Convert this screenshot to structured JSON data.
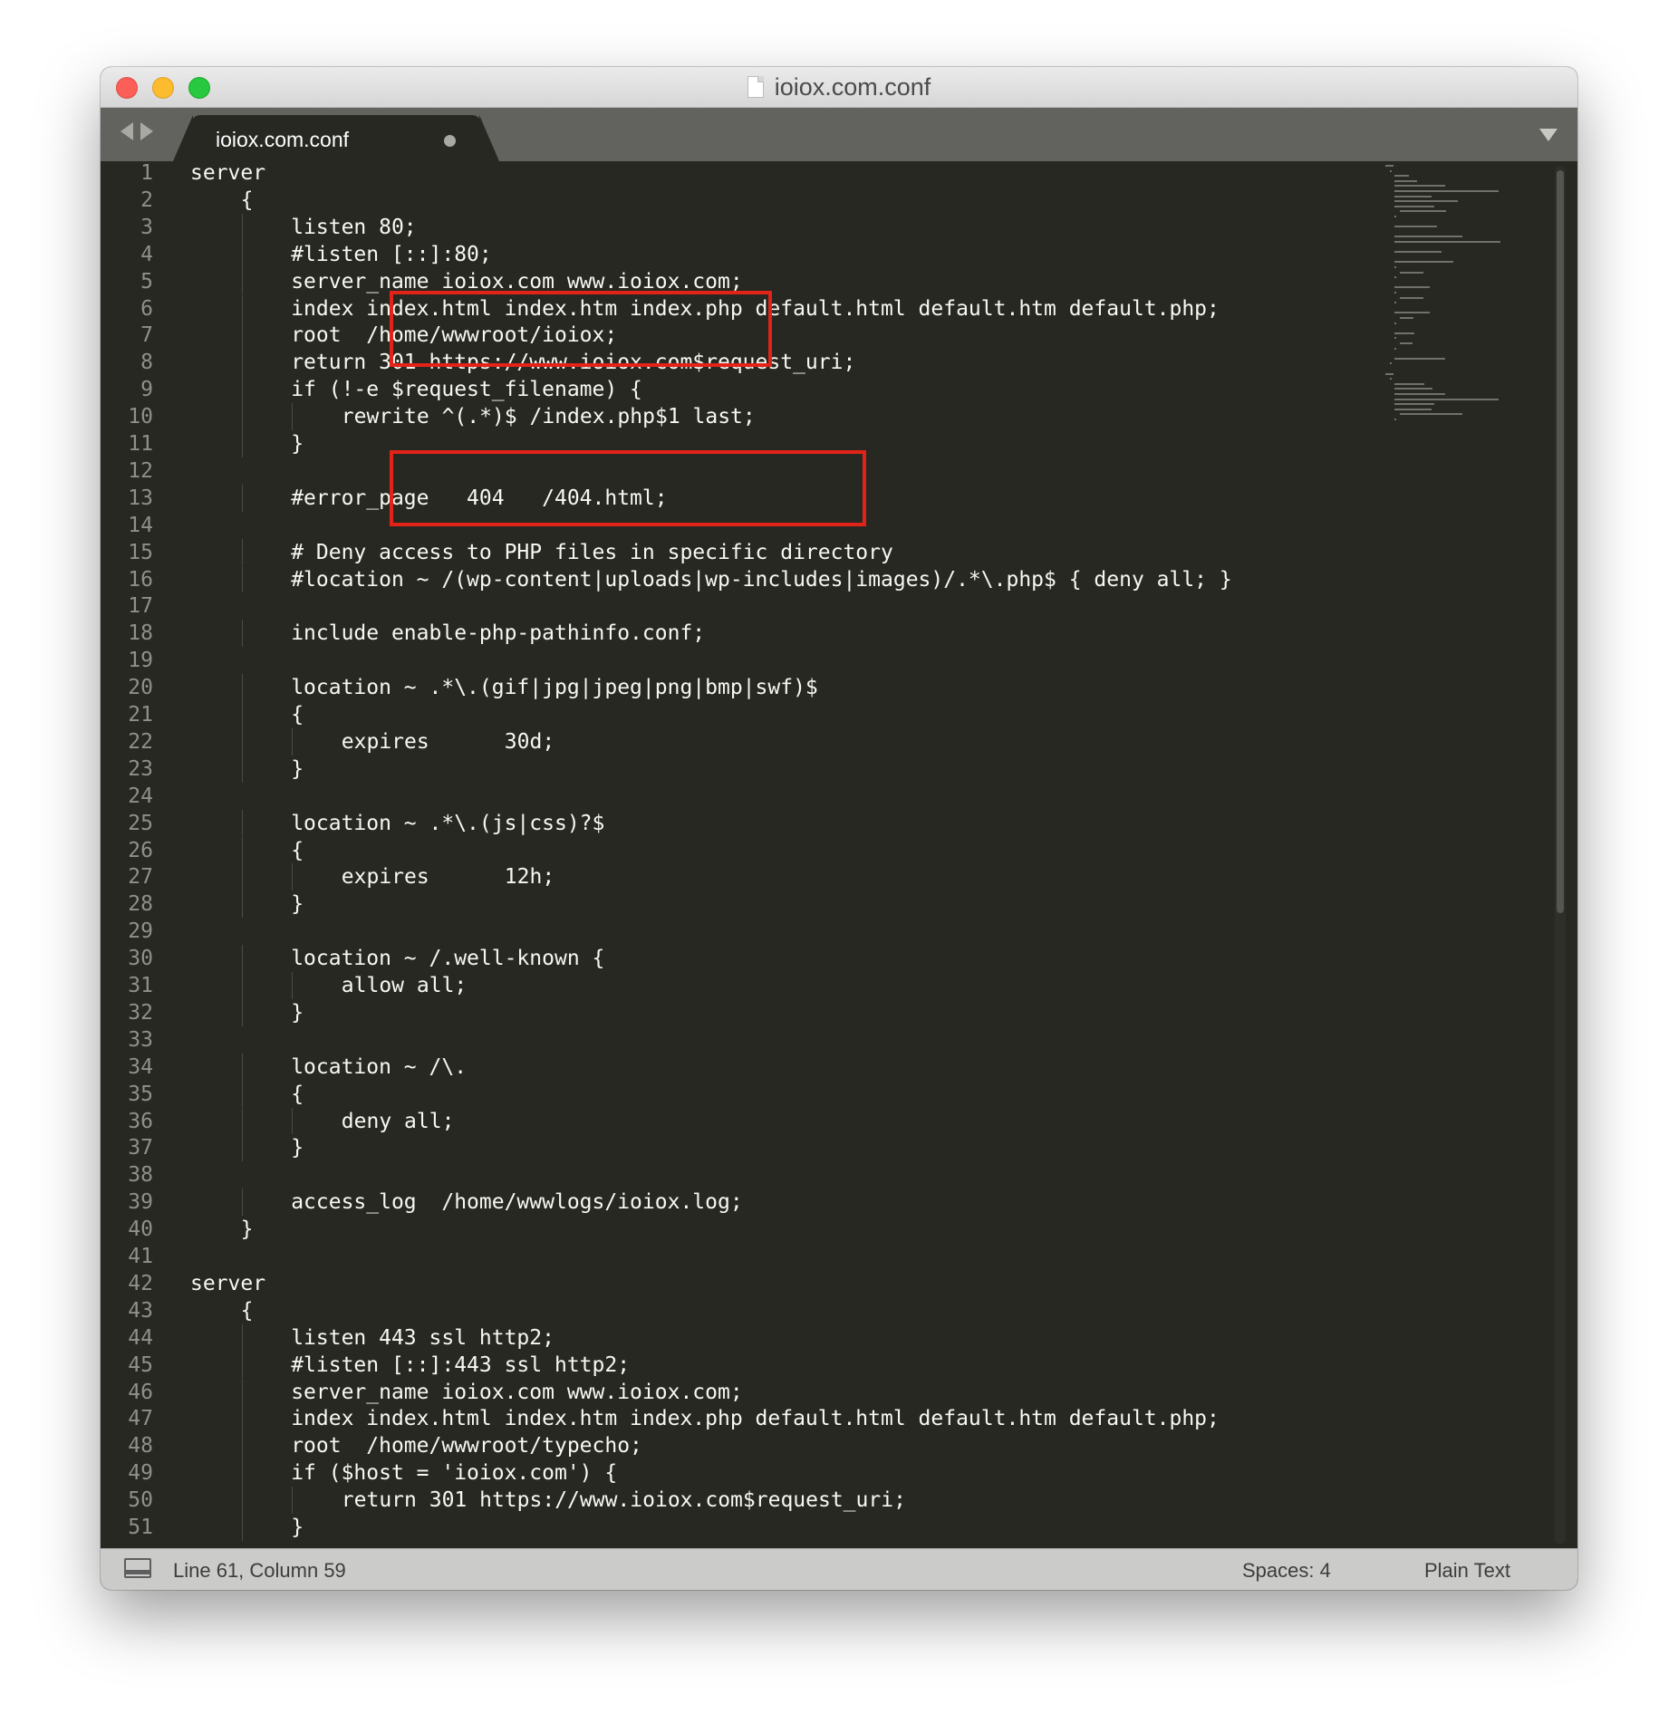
{
  "window": {
    "title": "ioiox.com.conf"
  },
  "tab": {
    "label": "ioiox.com.conf"
  },
  "editor": {
    "lines": [
      {
        "n": "1",
        "text": "server",
        "indent": 0
      },
      {
        "n": "2",
        "text": "{",
        "indent": 4
      },
      {
        "n": "3",
        "text": "listen 80;",
        "indent": 8
      },
      {
        "n": "4",
        "text": "#listen [::]:80;",
        "indent": 8
      },
      {
        "n": "5",
        "text": "server_name ioiox.com www.ioiox.com;",
        "indent": 8
      },
      {
        "n": "6",
        "text": "index index.html index.htm index.php default.html default.htm default.php;",
        "indent": 8
      },
      {
        "n": "7",
        "text": "root  /home/wwwroot/ioiox;",
        "indent": 8
      },
      {
        "n": "8",
        "text": "return 301 https://www.ioiox.com$request_uri;",
        "indent": 8
      },
      {
        "n": "9",
        "text": "if (!-e $request_filename) {",
        "indent": 8
      },
      {
        "n": "10",
        "text": "rewrite ^(.*)$ /index.php$1 last;",
        "indent": 12
      },
      {
        "n": "11",
        "text": "}",
        "indent": 8
      },
      {
        "n": "12",
        "text": "",
        "indent": 0
      },
      {
        "n": "13",
        "text": "#error_page   404   /404.html;",
        "indent": 8
      },
      {
        "n": "14",
        "text": "",
        "indent": 0
      },
      {
        "n": "15",
        "text": "# Deny access to PHP files in specific directory",
        "indent": 8
      },
      {
        "n": "16",
        "text": "#location ~ /(wp-content|uploads|wp-includes|images)/.*\\.php$ { deny all; }",
        "indent": 8
      },
      {
        "n": "17",
        "text": "",
        "indent": 0
      },
      {
        "n": "18",
        "text": "include enable-php-pathinfo.conf;",
        "indent": 8
      },
      {
        "n": "19",
        "text": "",
        "indent": 0
      },
      {
        "n": "20",
        "text": "location ~ .*\\.(gif|jpg|jpeg|png|bmp|swf)$",
        "indent": 8
      },
      {
        "n": "21",
        "text": "{",
        "indent": 8
      },
      {
        "n": "22",
        "text": "expires      30d;",
        "indent": 12
      },
      {
        "n": "23",
        "text": "}",
        "indent": 8
      },
      {
        "n": "24",
        "text": "",
        "indent": 0
      },
      {
        "n": "25",
        "text": "location ~ .*\\.(js|css)?$",
        "indent": 8
      },
      {
        "n": "26",
        "text": "{",
        "indent": 8
      },
      {
        "n": "27",
        "text": "expires      12h;",
        "indent": 12
      },
      {
        "n": "28",
        "text": "}",
        "indent": 8
      },
      {
        "n": "29",
        "text": "",
        "indent": 0
      },
      {
        "n": "30",
        "text": "location ~ /.well-known {",
        "indent": 8
      },
      {
        "n": "31",
        "text": "allow all;",
        "indent": 12
      },
      {
        "n": "32",
        "text": "}",
        "indent": 8
      },
      {
        "n": "33",
        "text": "",
        "indent": 0
      },
      {
        "n": "34",
        "text": "location ~ /\\.",
        "indent": 8
      },
      {
        "n": "35",
        "text": "{",
        "indent": 8
      },
      {
        "n": "36",
        "text": "deny all;",
        "indent": 12
      },
      {
        "n": "37",
        "text": "}",
        "indent": 8
      },
      {
        "n": "38",
        "text": "",
        "indent": 0
      },
      {
        "n": "39",
        "text": "access_log  /home/wwwlogs/ioiox.log;",
        "indent": 8
      },
      {
        "n": "40",
        "text": "}",
        "indent": 4
      },
      {
        "n": "41",
        "text": "",
        "indent": 0
      },
      {
        "n": "42",
        "text": "server",
        "indent": 0
      },
      {
        "n": "43",
        "text": "{",
        "indent": 4
      },
      {
        "n": "44",
        "text": "listen 443 ssl http2;",
        "indent": 8
      },
      {
        "n": "45",
        "text": "#listen [::]:443 ssl http2;",
        "indent": 8
      },
      {
        "n": "46",
        "text": "server_name ioiox.com www.ioiox.com;",
        "indent": 8
      },
      {
        "n": "47",
        "text": "index index.html index.htm index.php default.html default.htm default.php;",
        "indent": 8
      },
      {
        "n": "48",
        "text": "root  /home/wwwroot/typecho;",
        "indent": 8
      },
      {
        "n": "49",
        "text": "if ($host = 'ioiox.com') {",
        "indent": 8
      },
      {
        "n": "50",
        "text": "return 301 https://www.ioiox.com$request_uri;",
        "indent": 12
      },
      {
        "n": "51",
        "text": "}",
        "indent": 8
      }
    ]
  },
  "status": {
    "position": "Line 61, Column 59",
    "indentation": "Spaces: 4",
    "syntax": "Plain Text"
  },
  "colors": {
    "editor_background": "#272822",
    "text": "#f8f8f2",
    "line_numbers": "#90908a",
    "annotation_box": "#e2231a"
  }
}
